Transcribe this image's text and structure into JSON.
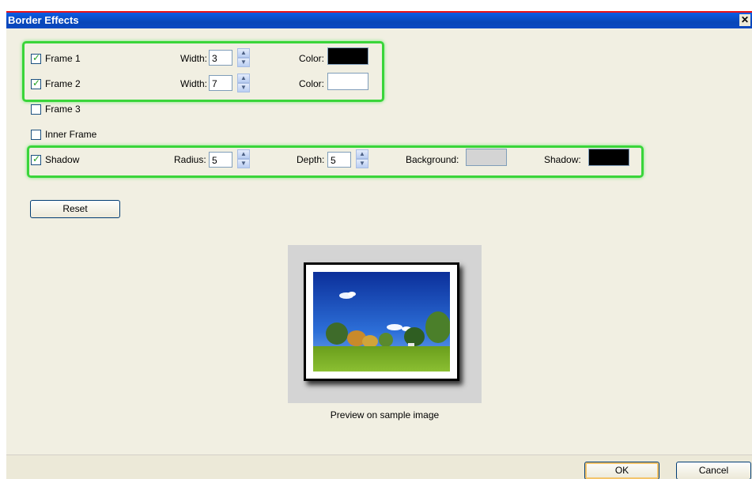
{
  "window": {
    "title": "Border Effects",
    "close_glyph": "✕"
  },
  "frames": [
    {
      "label": "Frame 1",
      "checked": true,
      "width_label": "Width:",
      "width_value": "3",
      "color_label": "Color:",
      "color": "#000000"
    },
    {
      "label": "Frame 2",
      "checked": true,
      "width_label": "Width:",
      "width_value": "7",
      "color_label": "Color:",
      "color": "#ffffff"
    },
    {
      "label": "Frame 3",
      "checked": false
    },
    {
      "label": "Inner Frame",
      "checked": false
    }
  ],
  "shadow": {
    "label": "Shadow",
    "checked": true,
    "radius_label": "Radius:",
    "radius_value": "5",
    "depth_label": "Depth:",
    "depth_value": "5",
    "background_label": "Background:",
    "background_color": "#d4d4d4",
    "shadow_label": "Shadow:",
    "shadow_color": "#000000"
  },
  "buttons": {
    "reset": "Reset",
    "ok": "OK",
    "cancel": "Cancel"
  },
  "preview": {
    "caption": "Preview on sample image"
  },
  "icons": {
    "check": "check-icon",
    "spin_up": "chevron-up-icon",
    "spin_down": "chevron-down-icon",
    "close": "close-icon"
  },
  "colors": {
    "highlight": "#3ad53a",
    "titlebar": "#0a5ae0",
    "annotation_border": "#e8141a"
  }
}
